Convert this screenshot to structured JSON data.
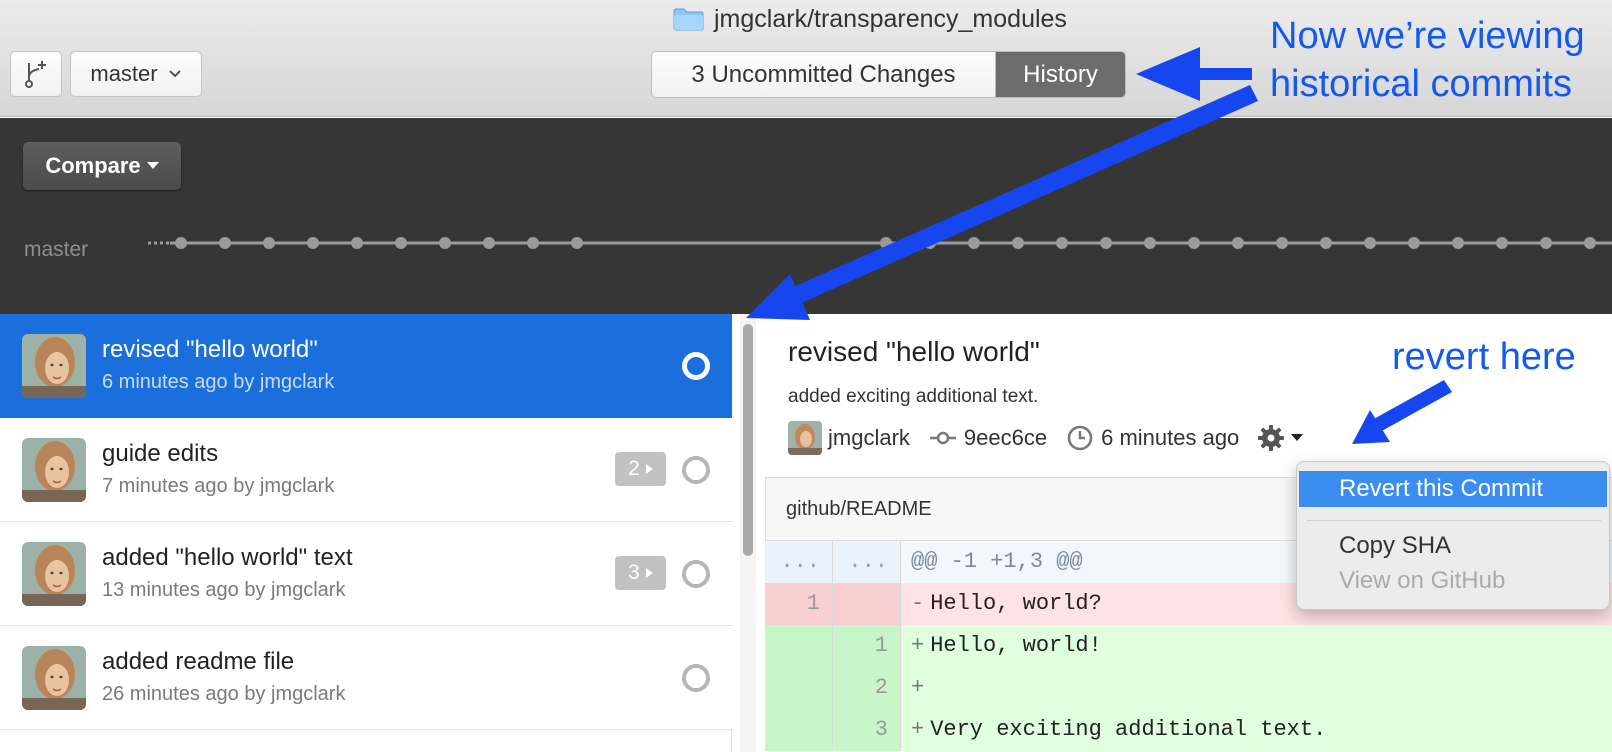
{
  "toolbar": {
    "repo_title": "jmgclark/transparency_modules",
    "branch_button_icon": "branch-add-icon",
    "branch_name": "master",
    "tabs": [
      {
        "label": "3 Uncommitted Changes",
        "active": false
      },
      {
        "label": "History",
        "active": true
      }
    ]
  },
  "compare": {
    "button_label": "Compare",
    "timeline_label": "master"
  },
  "commits": [
    {
      "title": "revised \"hello world\"",
      "meta": "6 minutes ago by jmgclark",
      "count": "",
      "selected": true
    },
    {
      "title": "guide edits",
      "meta": "7 minutes ago by jmgclark",
      "count": "2",
      "selected": false
    },
    {
      "title": "added \"hello world\" text",
      "meta": "13 minutes ago by jmgclark",
      "count": "3",
      "selected": false
    },
    {
      "title": "added readme file",
      "meta": "26 minutes ago by jmgclark",
      "count": "",
      "selected": false
    }
  ],
  "detail": {
    "title": "revised \"hello world\"",
    "description": "added exciting additional text.",
    "author": "jmgclark",
    "sha": "9eec6ce",
    "time": "6 minutes ago",
    "file": "github/README"
  },
  "diff": [
    {
      "type": "hunk",
      "old": "...",
      "new": "...",
      "text": "@@ -1 +1,3 @@"
    },
    {
      "type": "del",
      "old": "1",
      "new": "",
      "sign": "-",
      "text": "Hello, world?"
    },
    {
      "type": "add",
      "old": "",
      "new": "1",
      "sign": "+",
      "text": "Hello, world!"
    },
    {
      "type": "add",
      "old": "",
      "new": "2",
      "sign": "+",
      "text": ""
    },
    {
      "type": "add",
      "old": "",
      "new": "3",
      "sign": "+",
      "text": "Very exciting additional text."
    }
  ],
  "context_menu": {
    "items": [
      "Revert this Commit",
      "Copy SHA",
      "View on GitHub"
    ],
    "disabled": [
      "View on GitHub"
    ]
  },
  "annotations": {
    "line1": "Now we’re viewing",
    "line2": "historical commits",
    "revert": "revert here"
  },
  "colors": {
    "selection_blue": "#1a6fdc",
    "annotation_blue": "#1259f2",
    "dark_panel": "#363636",
    "diff_deleted": "#ffe2e3",
    "diff_added": "#e0ffdf"
  }
}
